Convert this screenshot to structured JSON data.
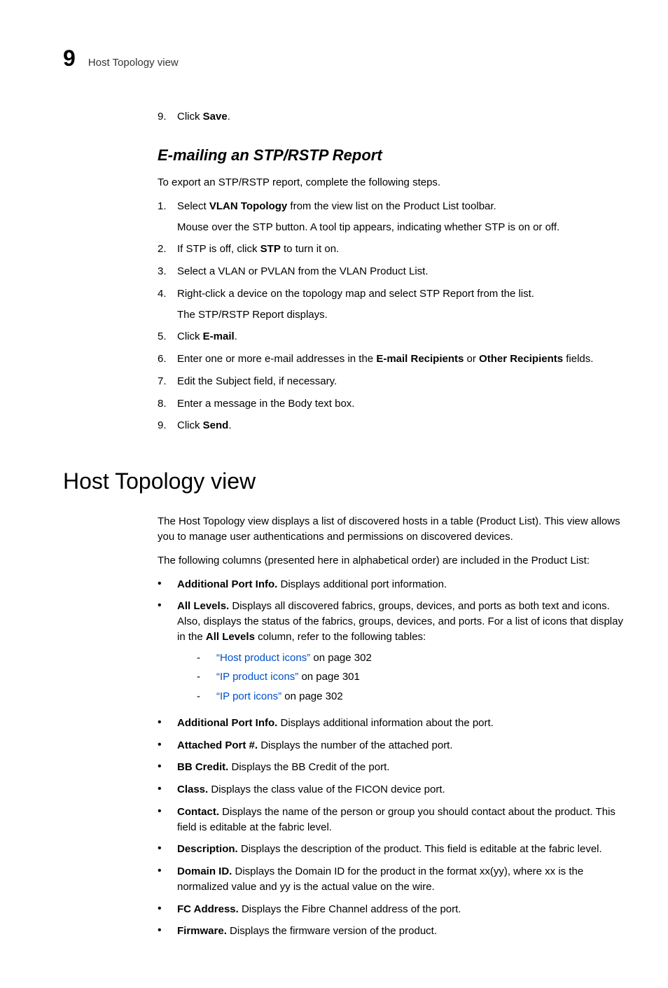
{
  "header": {
    "chapter_number": "9",
    "running_title": "Host Topology view"
  },
  "pre_steps": [
    {
      "n": "9.",
      "prefix": "Click ",
      "bold": "Save",
      "suffix": "."
    }
  ],
  "section_email": {
    "title": "E-mailing an STP/RSTP Report",
    "intro": "To export an STP/RSTP report, complete the following steps.",
    "steps": [
      {
        "n": "1.",
        "parts": [
          {
            "t": "Select "
          },
          {
            "t": "VLAN Topology",
            "b": true
          },
          {
            "t": " from the view list on the Product List toolbar."
          }
        ],
        "sub": "Mouse over the STP button. A tool tip appears, indicating whether STP is on or off."
      },
      {
        "n": "2.",
        "parts": [
          {
            "t": "If STP is off, click "
          },
          {
            "t": "STP",
            "b": true
          },
          {
            "t": " to turn it on."
          }
        ]
      },
      {
        "n": "3.",
        "parts": [
          {
            "t": "Select a VLAN or PVLAN from the VLAN Product List."
          }
        ]
      },
      {
        "n": "4.",
        "parts": [
          {
            "t": "Right-click a device on the topology map and select STP Report from the list."
          }
        ],
        "sub": "The STP/RSTP Report displays."
      },
      {
        "n": "5.",
        "parts": [
          {
            "t": "Click "
          },
          {
            "t": "E-mail",
            "b": true
          },
          {
            "t": "."
          }
        ]
      },
      {
        "n": "6.",
        "parts": [
          {
            "t": "Enter one or more e-mail addresses in the "
          },
          {
            "t": "E-mail Recipients",
            "b": true
          },
          {
            "t": " or "
          },
          {
            "t": "Other Recipients",
            "b": true
          },
          {
            "t": " fields."
          }
        ]
      },
      {
        "n": "7.",
        "parts": [
          {
            "t": "Edit the Subject field, if necessary."
          }
        ]
      },
      {
        "n": "8.",
        "parts": [
          {
            "t": "Enter a message in the Body text box."
          }
        ]
      },
      {
        "n": "9.",
        "parts": [
          {
            "t": "Click "
          },
          {
            "t": "Send",
            "b": true
          },
          {
            "t": "."
          }
        ]
      }
    ]
  },
  "section_main": {
    "title": "Host Topology view",
    "para1": "The Host Topology view displays a list of discovered hosts in a table (Product List). This view allows you to manage user authentications and permissions on discovered devices.",
    "para2": "The following columns (presented here in alphabetical order) are included in the Product List:",
    "bullets": [
      {
        "term": "Additional Port Info.",
        "desc": " Displays additional port information."
      },
      {
        "term": "All Levels.",
        "desc_parts": [
          {
            "t": " Displays all discovered fabrics, groups, devices, and ports as both text and icons. Also, displays the status of the fabrics, groups, devices, and ports. For a list of icons that display in the "
          },
          {
            "t": "All Levels",
            "b": true
          },
          {
            "t": " column, refer to the following tables:"
          }
        ],
        "subs": [
          {
            "link": "“Host product icons”",
            "tail": " on page 302"
          },
          {
            "link": "“IP product icons”",
            "tail": " on page 301"
          },
          {
            "link": "“IP port icons”",
            "tail": " on page 302"
          }
        ]
      },
      {
        "term": "Additional Port Info.",
        "desc": " Displays additional information about the port."
      },
      {
        "term": "Attached Port #.",
        "desc": " Displays the number of the attached port."
      },
      {
        "term": "BB Credit.",
        "desc": " Displays the BB Credit of the port."
      },
      {
        "term": "Class.",
        "desc": " Displays the class value of the FICON device port."
      },
      {
        "term": "Contact.",
        "desc": " Displays the name of the person or group you should contact about the product. This field is editable at the fabric level."
      },
      {
        "term": "Description.",
        "desc": " Displays the description of the product. This field is editable at the fabric level."
      },
      {
        "term": "Domain ID.",
        "desc": " Displays the Domain ID for the product in the format xx(yy), where xx is the normalized value and yy is the actual value on the wire."
      },
      {
        "term": "FC Address.",
        "desc": " Displays the Fibre Channel address of the port."
      },
      {
        "term": "Firmware.",
        "desc": " Displays the firmware version of the product."
      }
    ]
  }
}
